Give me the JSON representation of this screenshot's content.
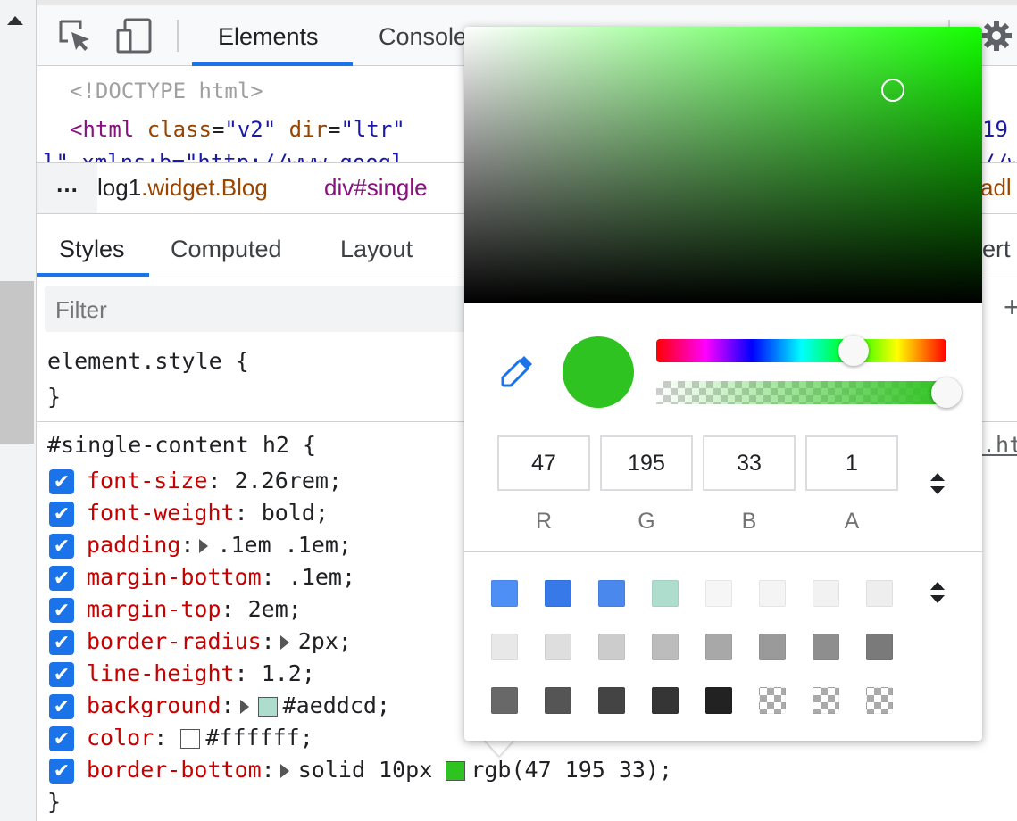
{
  "toolbar": {
    "tabs": [
      "Elements",
      "Console"
    ]
  },
  "dom": {
    "doctype": "<!DOCTYPE html>",
    "html_open": "<html",
    "attr_class": "class",
    "val_class": "\"v2\"",
    "attr_dir": "dir",
    "val_dir": "\"ltr\"",
    "partial_line": "l\" xmlns:b=\"http://www.googl",
    "right_edge_1": "19",
    "right_edge_2": "//w"
  },
  "breadcrumb": {
    "dots": "…",
    "item1_prefix": "log1",
    "item1_suffix": ".widget.Blog",
    "item2": "div#single",
    "right_edge": "adl"
  },
  "subtabs": [
    "Styles",
    "Computed",
    "Layout"
  ],
  "subtabs_right_edge": "ert",
  "filter": {
    "placeholder": "Filter"
  },
  "plus_sign": "+",
  "element_style": {
    "selector": "element.style {",
    "close": "}"
  },
  "rule": {
    "selector": "#single-content h2 {",
    "close": "}",
    "source_edge": ".ht",
    "declarations": [
      {
        "prop": "font-size",
        "value": "2.26rem;",
        "expand": false
      },
      {
        "prop": "font-weight",
        "value": "bold;",
        "expand": false
      },
      {
        "prop": "padding",
        "value": ".1em .1em;",
        "expand": true
      },
      {
        "prop": "margin-bottom",
        "value": ".1em;",
        "expand": false
      },
      {
        "prop": "margin-top",
        "value": "2em;",
        "expand": false
      },
      {
        "prop": "border-radius",
        "value": "2px;",
        "expand": true
      },
      {
        "prop": "line-height",
        "value": "1.2;",
        "expand": false
      },
      {
        "prop": "background",
        "value": "#aeddcd;",
        "expand": true,
        "swatch": "#aeddcd"
      },
      {
        "prop": "color",
        "value": "#ffffff;",
        "expand": false,
        "swatch": "#ffffff"
      },
      {
        "prop": "border-bottom",
        "value": "rgb(47 195 33);",
        "pre_value": "solid 10px",
        "expand": true,
        "swatch": "#2fc321"
      }
    ]
  },
  "color_picker": {
    "current_color": "#2fc321",
    "hue_color": "#13ff00",
    "hue_level": 0.68,
    "alpha_level": 1,
    "channels": [
      {
        "label": "R",
        "value": "47"
      },
      {
        "label": "G",
        "value": "195"
      },
      {
        "label": "B",
        "value": "33"
      },
      {
        "label": "A",
        "value": "1"
      }
    ],
    "palette": [
      [
        "#4d8ff5",
        "#3779e8",
        "#4a88ee",
        "#aeddcd",
        "#f6f6f6",
        "#f4f4f4",
        "#f2f2f2",
        "#eeeeee"
      ],
      [
        "#e8e8e8",
        "#dedede",
        "#cccccc",
        "#bcbcbc",
        "#a8a8a8",
        "#9a9a9a",
        "#8e8e8e",
        "#7a7a7a"
      ],
      [
        "#686868",
        "#555555",
        "#444444",
        "#353535",
        "#222222",
        "checker",
        "checker",
        "checker"
      ]
    ]
  }
}
